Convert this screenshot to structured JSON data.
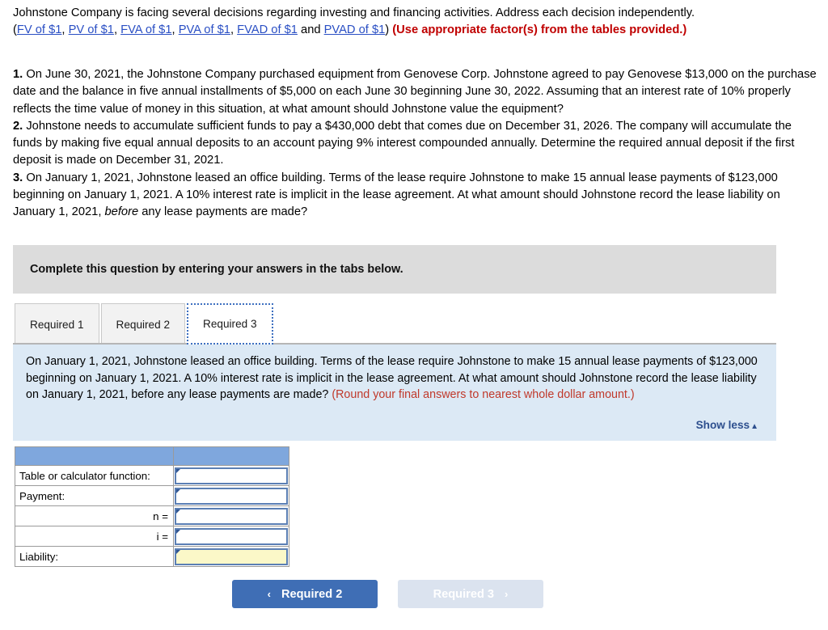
{
  "intro": {
    "sentence": "Johnstone Company is facing several decisions regarding investing and financing activities. Address each decision independently.",
    "open_paren": "(",
    "links": [
      "FV of $1",
      "PV of $1",
      "FVA of $1",
      "PVA of $1",
      "FVAD of $1",
      "PVAD of $1"
    ],
    "sep_comma": ", ",
    "sep_and": " and ",
    "close_paren": ")",
    "use_factors": "(Use appropriate factor(s) from the tables provided.)"
  },
  "questions": [
    {
      "num": "1.",
      "text": " On June 30, 2021, the Johnstone Company purchased equipment from Genovese Corp. Johnstone agreed to pay Genovese $13,000 on the purchase date and the balance in five annual installments of $5,000 on each June 30 beginning June 30, 2022. Assuming that an interest rate of 10% properly reflects the time value of money in this situation, at what amount should Johnstone value the equipment?"
    },
    {
      "num": "2.",
      "text": " Johnstone needs to accumulate sufficient funds to pay a $430,000 debt that comes due on December 31, 2026. The company will accumulate the funds by making five equal annual deposits to an account paying 9% interest compounded annually. Determine the required annual deposit if the first deposit is made on December 31, 2021."
    },
    {
      "num": "3.",
      "text_before_italic": " On January 1, 2021, Johnstone leased an office building. Terms of the lease require Johnstone to make 15 annual lease payments of $123,000 beginning on January 1, 2021. A 10% interest rate is implicit in the lease agreement. At what amount should Johnstone record the lease liability on January 1, 2021, ",
      "italic": "before",
      "text_after_italic": " any lease payments are made?"
    }
  ],
  "instruction_bar": {
    "text": "Complete this question by entering your answers in the tabs below."
  },
  "tabs": [
    {
      "label": "Required 1",
      "active": false
    },
    {
      "label": "Required 2",
      "active": false
    },
    {
      "label": "Required 3",
      "active": true
    }
  ],
  "blue_panel": {
    "text": "On January 1, 2021, Johnstone leased an office building. Terms of the lease require Johnstone to make 15 annual lease payments of $123,000 beginning on January 1, 2021. A 10% interest rate is implicit in the lease agreement. At what amount should Johnstone record the lease liability on January 1, 2021, before any lease payments are made? ",
    "round_note": "(Round your final answers to nearest whole dollar amount.)",
    "show_less_label": "Show less",
    "show_less_caret": "▲"
  },
  "answer_table": {
    "header": [
      "",
      ""
    ],
    "rows": [
      {
        "label": "Table or calculator function:",
        "align": "left",
        "value": "",
        "highlight": false
      },
      {
        "label": "Payment:",
        "align": "left",
        "value": "",
        "highlight": false
      },
      {
        "label": "n =",
        "align": "right",
        "value": "",
        "highlight": false
      },
      {
        "label": "i =",
        "align": "right",
        "value": "",
        "highlight": false
      },
      {
        "label": "Liability:",
        "align": "left",
        "value": "",
        "highlight": true
      }
    ]
  },
  "nav": {
    "prev_label": "Required 2",
    "prev_chev": "‹",
    "next_label": "Required 3",
    "next_chev": "›"
  },
  "colors": {
    "link_blue": "#2a4fc4",
    "alert_red": "#c00000",
    "panel_blue": "#dce9f5",
    "banner_gray": "#dcdcdc",
    "table_header_blue": "#7fa7dd",
    "input_border_blue": "#5b7fb4",
    "highlight_yellow": "#fbf8c8",
    "button_blue": "#3f6eb5",
    "button_disabled": "#dbe3ef"
  }
}
